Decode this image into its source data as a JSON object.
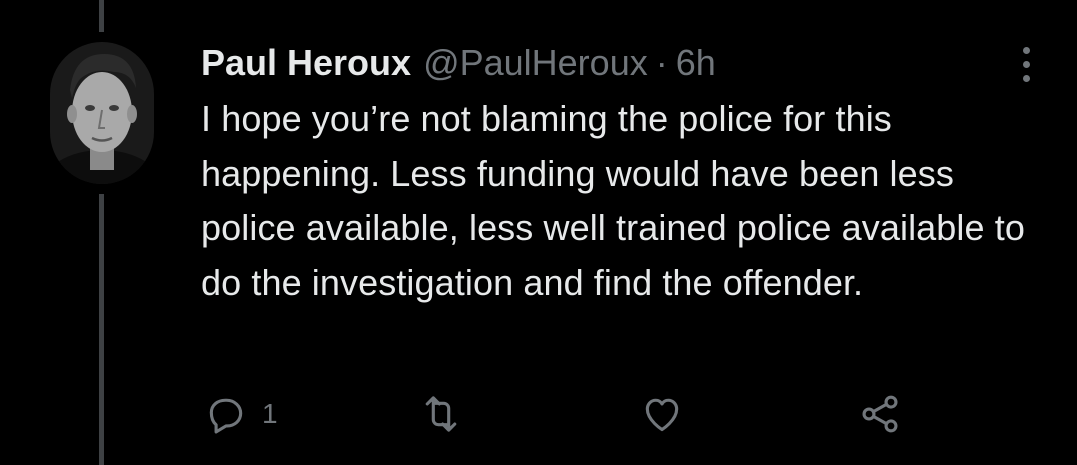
{
  "tweet": {
    "display_name": "Paul Heroux",
    "handle": "@PaulHeroux",
    "separator": "·",
    "time": "6h",
    "text": "I hope you’re not blaming the police for this happening. Less funding would have been less police available, less well trained police available to do the investigation and find the offender."
  },
  "actions": {
    "reply_count": "1",
    "reply_icon": "reply-icon",
    "retweet_icon": "retweet-icon",
    "like_icon": "heart-icon",
    "share_icon": "share-icon",
    "more_icon": "more-icon"
  },
  "colors": {
    "background": "#000000",
    "primary_text": "#e7e9ea",
    "secondary_text": "#71767b",
    "thread_line": "#3e4144"
  }
}
